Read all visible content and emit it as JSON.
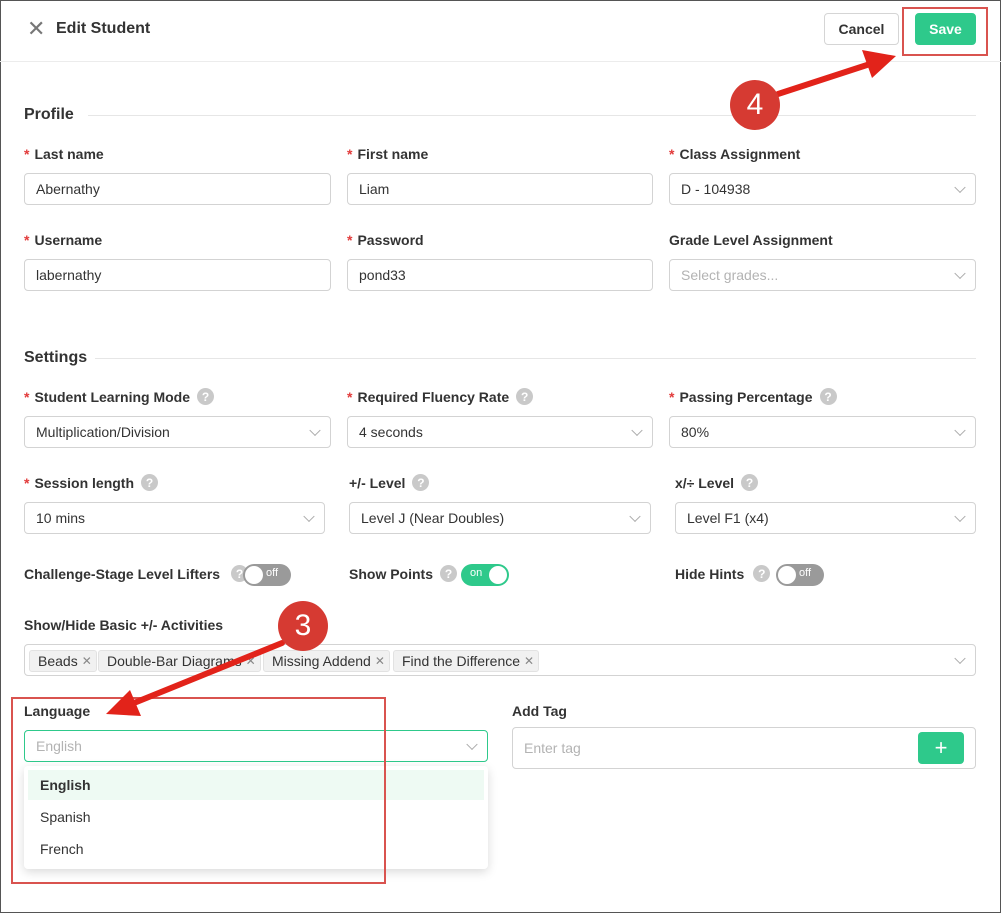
{
  "header": {
    "title": "Edit Student",
    "close_icon": "close-icon",
    "cancel_label": "Cancel",
    "save_label": "Save"
  },
  "profile": {
    "section_title": "Profile",
    "last_name": {
      "label": "Last name",
      "value": "Abernathy"
    },
    "first_name": {
      "label": "First name",
      "value": "Liam"
    },
    "class_assignment": {
      "label": "Class Assignment",
      "value": "D - 104938"
    },
    "username": {
      "label": "Username",
      "value": "labernathy"
    },
    "password": {
      "label": "Password",
      "value": "pond33"
    },
    "grade_level": {
      "label": "Grade Level Assignment",
      "placeholder": "Select grades..."
    }
  },
  "settings": {
    "section_title": "Settings",
    "learning_mode": {
      "label": "Student Learning Mode",
      "value": "Multiplication/Division"
    },
    "fluency_rate": {
      "label": "Required Fluency Rate",
      "value": "4 seconds"
    },
    "passing_pct": {
      "label": "Passing Percentage",
      "value": "80%"
    },
    "session_length": {
      "label": "Session length",
      "value": "10 mins"
    },
    "addsub_level": {
      "label": "+/- Level",
      "value": "Level J (Near Doubles)"
    },
    "muldiv_level": {
      "label": "x/÷ Level",
      "value": "Level F1 (x4)"
    },
    "challenge_lifters": {
      "label": "Challenge-Stage Level Lifters",
      "state": "off"
    },
    "show_points": {
      "label": "Show Points",
      "state": "on"
    },
    "hide_hints": {
      "label": "Hide Hints",
      "state": "off"
    },
    "activities": {
      "label": "Show/Hide Basic +/- Activities",
      "tags": [
        "Beads",
        "Double-Bar Diagrams",
        "Missing Addend",
        "Find the Difference"
      ]
    },
    "language": {
      "label": "Language",
      "placeholder": "English",
      "options": [
        "English",
        "Spanish",
        "French"
      ],
      "selected": "English"
    },
    "add_tag": {
      "label": "Add Tag",
      "placeholder": "Enter tag",
      "button": "+"
    }
  },
  "annotations": {
    "step3": "3",
    "step4": "4"
  },
  "colors": {
    "accent": "#2ec98b",
    "required": "#e23b3b",
    "annotation_red": "#d63a32"
  }
}
